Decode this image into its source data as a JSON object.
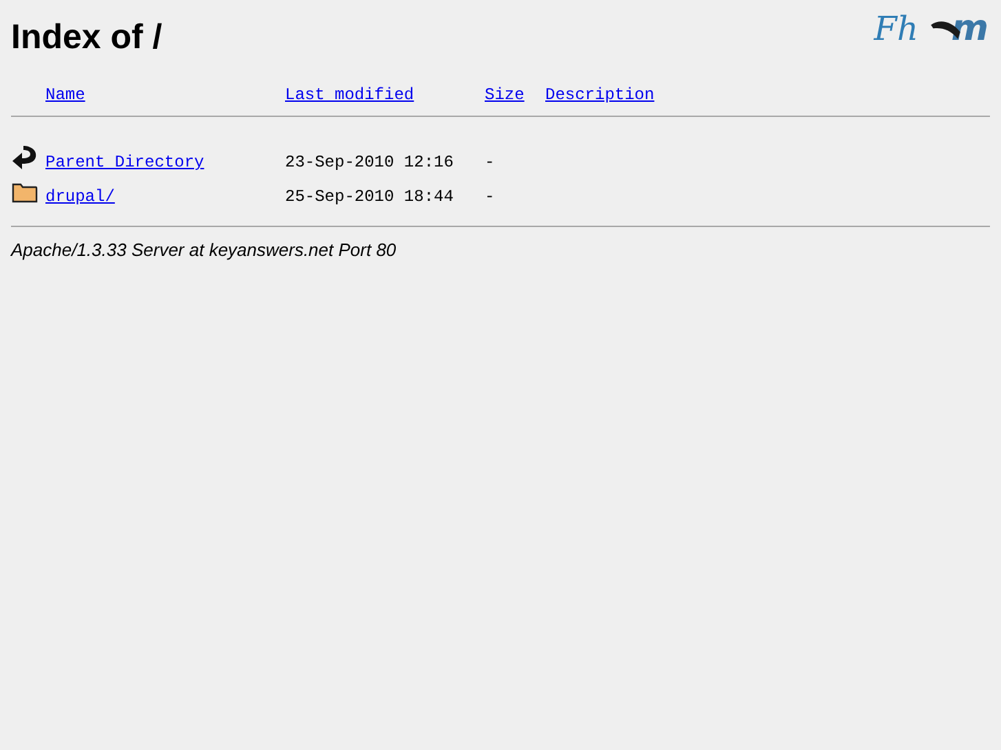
{
  "title": "Index of /",
  "logos": [
    {
      "kind": "script",
      "text": "Fh"
    },
    {
      "kind": "swoosh",
      "text": "m"
    }
  ],
  "columns": [
    "Name",
    "Last modified",
    "Size",
    "Description"
  ],
  "rows": [
    {
      "kind": "parent",
      "name": "Parent Directory",
      "modified": "23-Sep-2010 12:16",
      "size": "-"
    },
    {
      "kind": "folder",
      "name": "drupal/",
      "modified": "25-Sep-2010 18:44",
      "size": "-"
    }
  ],
  "footer": "Apache/1.3.33 Server at keyanswers.net Port 80"
}
